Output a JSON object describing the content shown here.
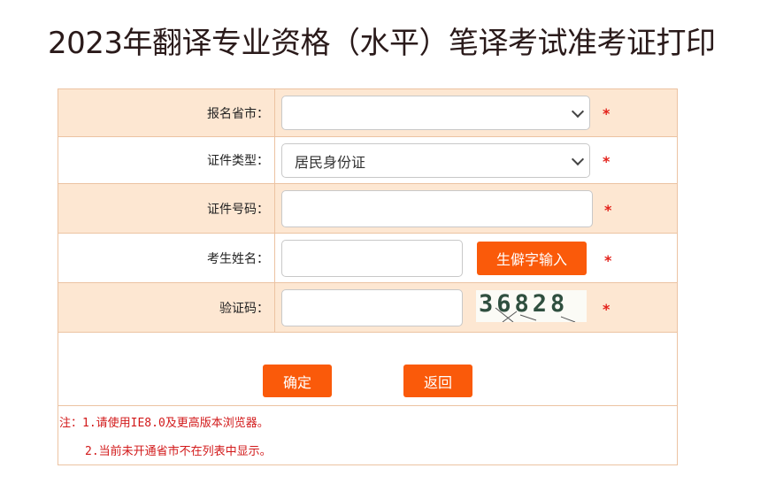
{
  "page": {
    "title": "2023年翻译专业资格（水平）笔译考试准考证打印"
  },
  "form": {
    "province": {
      "label": "报名省市：",
      "value": ""
    },
    "id_type": {
      "label": "证件类型：",
      "value": "居民身份证"
    },
    "id_number": {
      "label": "证件号码：",
      "value": ""
    },
    "name": {
      "label": "考生姓名：",
      "value": "",
      "rare_char_button": "生僻字输入"
    },
    "captcha": {
      "label": "验证码：",
      "value": "",
      "code": "36828"
    },
    "required_mark": "*"
  },
  "actions": {
    "confirm": "确定",
    "back": "返回"
  },
  "notes": {
    "line1": "注：1.请使用IE8.0及更高版本浏览器。",
    "line2": "2.当前未开通省市不在列表中显示。"
  },
  "colors": {
    "accent": "#fa5a0a",
    "row_tint": "#fde7d2",
    "border": "#ecc3a2",
    "required": "#e3211a"
  }
}
